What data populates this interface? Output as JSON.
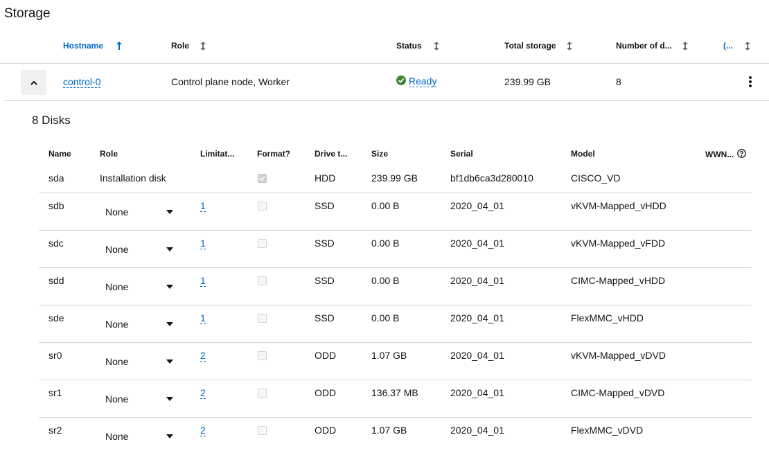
{
  "page": {
    "title": "Storage"
  },
  "hosts_table": {
    "columns": [
      {
        "label": "Hostname",
        "sort": "asc"
      },
      {
        "label": "Role",
        "sort": "none"
      },
      {
        "label": "Status",
        "sort": "none"
      },
      {
        "label": "Total storage",
        "sort": "none"
      },
      {
        "label": "Number of d...",
        "sort": "none"
      },
      {
        "label": "(...",
        "sort": "none"
      }
    ],
    "row": {
      "hostname": "control-0",
      "role": "Control plane node, Worker",
      "status": "Ready",
      "total_storage": "239.99 GB",
      "disk_count": "8"
    }
  },
  "disks": {
    "title": "8 Disks",
    "columns": {
      "name": "Name",
      "role": "Role",
      "limitations": "Limitat...",
      "format": "Format?",
      "drive_type": "Drive t...",
      "size": "Size",
      "serial": "Serial",
      "model": "Model",
      "wwn": "WWN..."
    },
    "rows": [
      {
        "name": "sda",
        "role": "Installation disk",
        "limitations": "",
        "format": true,
        "drive_type": "HDD",
        "size": "239.99 GB",
        "serial": "bf1db6ca3d280010",
        "model": "CISCO_VD"
      },
      {
        "name": "sdb",
        "role": "None",
        "limitations": "1",
        "format": false,
        "drive_type": "SSD",
        "size": "0.00 B",
        "serial": "2020_04_01",
        "model": "vKVM-Mapped_vHDD"
      },
      {
        "name": "sdc",
        "role": "None",
        "limitations": "1",
        "format": false,
        "drive_type": "SSD",
        "size": "0.00 B",
        "serial": "2020_04_01",
        "model": "vKVM-Mapped_vFDD"
      },
      {
        "name": "sdd",
        "role": "None",
        "limitations": "1",
        "format": false,
        "drive_type": "SSD",
        "size": "0.00 B",
        "serial": "2020_04_01",
        "model": "CIMC-Mapped_vHDD"
      },
      {
        "name": "sde",
        "role": "None",
        "limitations": "1",
        "format": false,
        "drive_type": "SSD",
        "size": "0.00 B",
        "serial": "2020_04_01",
        "model": "FlexMMC_vHDD"
      },
      {
        "name": "sr0",
        "role": "None",
        "limitations": "2",
        "format": false,
        "drive_type": "ODD",
        "size": "1.07 GB",
        "serial": "2020_04_01",
        "model": "vKVM-Mapped_vDVD"
      },
      {
        "name": "sr1",
        "role": "None",
        "limitations": "2",
        "format": false,
        "drive_type": "ODD",
        "size": "136.37 MB",
        "serial": "2020_04_01",
        "model": "CIMC-Mapped_vDVD"
      },
      {
        "name": "sr2",
        "role": "None",
        "limitations": "2",
        "format": false,
        "drive_type": "ODD",
        "size": "1.07 GB",
        "serial": "2020_04_01",
        "model": "FlexMMC_vDVD"
      }
    ]
  },
  "colors": {
    "link": "#0066cc",
    "success": "#3e8635",
    "border": "#d2d2d2",
    "text": "#151515"
  },
  "icons": {
    "sort_asc": "arrow-up-icon",
    "sort_none": "sort-updown-icon",
    "expand_toggle": "chevron-up-icon",
    "status_ready": "check-circle-icon",
    "row_actions": "kebab-icon",
    "wwn_help": "question-circle-icon"
  }
}
